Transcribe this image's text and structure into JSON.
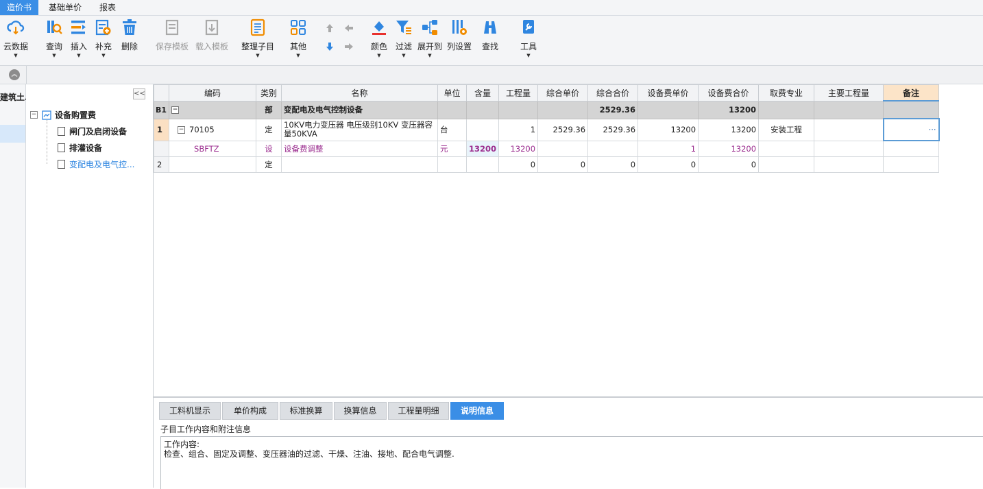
{
  "menubar": {
    "items": [
      "造价书",
      "基础单价",
      "报表"
    ]
  },
  "toolbar": {
    "cloud": "云数据",
    "query": "查询",
    "insert": "插入",
    "supplement": "补充",
    "delete": "删除",
    "save_template": "保存模板",
    "load_template": "载入模板",
    "organize": "整理子目",
    "other": "其他",
    "color": "颜色",
    "filter": "过滤",
    "expand_to": "展开到",
    "column_settings": "列设置",
    "find": "查找",
    "tools": "工具"
  },
  "leftnav": {
    "title": "建筑土..."
  },
  "tree": {
    "root": "设备购置费",
    "children": [
      "闸门及启闭设备",
      "排灌设备",
      "变配电及电气控..."
    ]
  },
  "grid": {
    "headers": [
      "编码",
      "类别",
      "名称",
      "单位",
      "含量",
      "工程量",
      "综合单价",
      "综合合价",
      "设备费单价",
      "设备费合价",
      "取费专业",
      "主要工程量",
      "备注"
    ],
    "part_row": {
      "label": "B1",
      "type": "部",
      "name": "变配电及电气控制设备",
      "total": "2529.36",
      "equip_total": "13200"
    },
    "row1": {
      "label": "1",
      "code": "70105",
      "type": "定",
      "name": "10KV电力变压器 电压级别10KV 变压器容量50KVA",
      "unit": "台",
      "qty": "1",
      "unit_price": "2529.36",
      "total_price": "2529.36",
      "equip_unit": "13200",
      "equip_total": "13200",
      "major": "安装工程",
      "note_btn": "···"
    },
    "subrow": {
      "code": "SBFTZ",
      "type": "设",
      "name": "设备费调整",
      "unit": "元",
      "content": "13200",
      "qty": "13200",
      "equip_unit": "1",
      "equip_total": "13200"
    },
    "row2": {
      "label": "2",
      "type": "定",
      "qty": "0",
      "unit_price": "0",
      "total_price": "0",
      "equip_unit": "0",
      "equip_total": "0"
    }
  },
  "bottom": {
    "tabs": [
      "工料机显示",
      "单价构成",
      "标准换算",
      "换算信息",
      "工程量明细",
      "说明信息"
    ],
    "section_title": "子目工作内容和附注信息",
    "content_line1": "工作内容:",
    "content_line2": "检查、组合、固定及调整、变压器油的过滤、干燥、注油、接地、配合电气调整."
  },
  "colors": {
    "accent": "#3a8ee6",
    "part_row": "#d4d4d4",
    "sub_row_text": "#9b2d8f"
  }
}
